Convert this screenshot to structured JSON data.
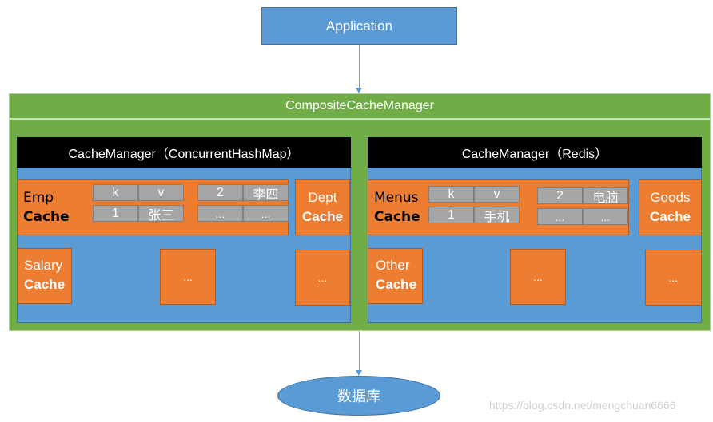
{
  "application": {
    "label": "Application"
  },
  "composite": {
    "title": "CompositeCacheManager"
  },
  "managers": [
    {
      "title": "CacheManager（ConcurrentHashMap）",
      "main_cache": {
        "line1": "Emp",
        "line2": "Cache"
      },
      "table_left": [
        [
          "k",
          "v"
        ],
        [
          "1",
          "张三"
        ]
      ],
      "table_right": [
        [
          "2",
          "李四"
        ],
        [
          "...",
          "..."
        ]
      ],
      "side_cache": {
        "line1": "Dept",
        "line2": "Cache"
      },
      "bottom_cache": {
        "line1": "Salary",
        "line2": "Cache"
      },
      "placeholder_mid": "...",
      "placeholder_right": "..."
    },
    {
      "title": "CacheManager（Redis）",
      "main_cache": {
        "line1": "Menus",
        "line2": "Cache"
      },
      "table_left": [
        [
          "k",
          "v"
        ],
        [
          "1",
          "手机"
        ]
      ],
      "table_right": [
        [
          "2",
          "电脑"
        ],
        [
          "...",
          "..."
        ]
      ],
      "side_cache": {
        "line1": "Goods",
        "line2": "Cache"
      },
      "bottom_cache": {
        "line1": "Other",
        "line2": "Cache"
      },
      "placeholder_mid": "...",
      "placeholder_right": "..."
    }
  ],
  "database": {
    "label": "数据库"
  },
  "watermark": "https://blog.csdn.net/mengchuan6666",
  "colors": {
    "application": "#5b9bd5",
    "composite": "#70ad47",
    "manager_header": "#000000",
    "manager_body": "#5b9bd5",
    "cache": "#ed7d31",
    "cell": "#a5a5a5"
  }
}
